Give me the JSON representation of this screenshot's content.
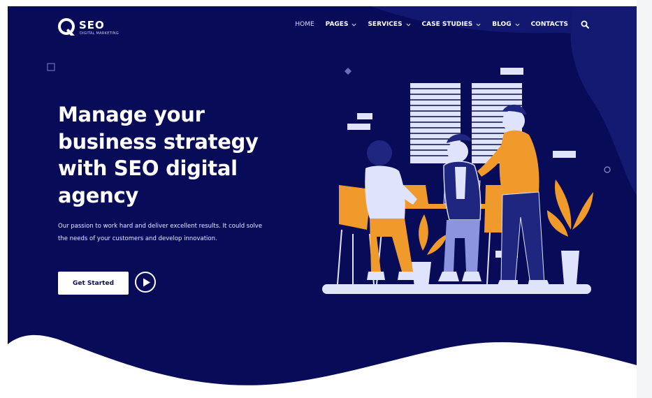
{
  "brand": {
    "name": "SEO",
    "tagline": "DIGITAL MARKETING"
  },
  "nav": {
    "items": [
      {
        "label": "HOME",
        "has_dropdown": false
      },
      {
        "label": "PAGES",
        "has_dropdown": true
      },
      {
        "label": "SERVICES",
        "has_dropdown": true
      },
      {
        "label": "CASE STUDIES",
        "has_dropdown": true
      },
      {
        "label": "BLOG",
        "has_dropdown": true
      },
      {
        "label": "CONTACTS",
        "has_dropdown": false
      }
    ],
    "search_icon": "search-icon"
  },
  "hero": {
    "headline": "Manage your business strategy with SEO digital agency",
    "subtext": "Our passion to work hard and deliver excellent results. It could solve the needs of your customers and develop innovation.",
    "cta_label": "Get Started",
    "play_icon": "play-icon"
  },
  "colors": {
    "hero_background": "#080c58",
    "blob": "#141a72",
    "accent_orange": "#ef9a2b",
    "light_panel": "#dfe3fb",
    "white": "#ffffff"
  }
}
